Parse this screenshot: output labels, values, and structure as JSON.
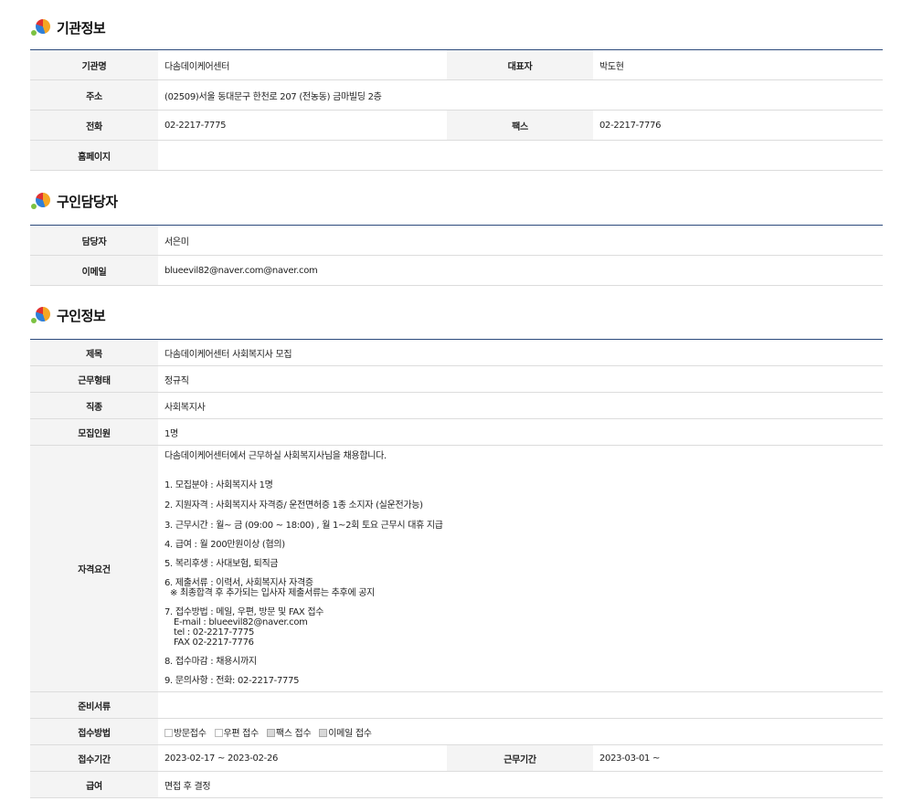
{
  "sections": {
    "org": {
      "title": "기관정보",
      "labels": {
        "name": "기관명",
        "rep": "대표자",
        "address": "주소",
        "phone": "전화",
        "fax": "팩스",
        "homepage": "홈페이지"
      },
      "values": {
        "name": "다솜데이케어센터",
        "rep": "박도현",
        "address": "(02509)서울 동대문구 한천로 207 (전농동) 금마빌딩 2층",
        "phone": "02-2217-7775",
        "fax": "02-2217-7776",
        "homepage": ""
      }
    },
    "contact": {
      "title": "구인담당자",
      "labels": {
        "person": "담당자",
        "email": "이메일"
      },
      "values": {
        "person": "서은미",
        "email": "blueevil82@naver.com@naver.com"
      }
    },
    "job": {
      "title": "구인정보",
      "labels": {
        "subject": "제목",
        "type": "근무형태",
        "category": "직종",
        "count": "모집인원",
        "qualification": "자격요건",
        "documents": "준비서류",
        "method": "접수방법",
        "period": "접수기간",
        "start": "근무기간",
        "salary": "급여"
      },
      "values": {
        "subject": "다솜데이케어센터 사회복지사 모집",
        "type": "정규직",
        "category": "사회복지사",
        "count": "1명",
        "qualification": {
          "intro": "다솜데이케어센터에서 근무하실 사회복지사님을 채용합니다.",
          "item1": "1. 모집분야 : 사회복지사 1명",
          "item2": "2. 지원자격 : 사회복지사 자격증/ 운전면허증 1종 소지자 (실운전가능)",
          "item3": "3. 근무시간 : 월~ 금 (09:00 ~ 18:00) , 월 1~2회 토요 근무시 대휴 지급",
          "item4": "4. 급여 : 월 200만원이상 (협의)",
          "item5": "5. 복리후생 : 사대보험, 퇴직금",
          "item6": "6. 제출서류 : 이력서, 사회복지사 자격증",
          "item6_note": "※ 최종합격 후 추가되는 입사자 제출서류는 추후에 공지",
          "item7": "7. 접수방법 : 메일, 우편, 방문 및 FAX 접수",
          "item7_email": "E-mail : blueevil82@naver.com",
          "item7_tel": "tel : 02-2217-7775",
          "item7_fax": "FAX 02-2217-7776",
          "item8": "8. 접수마감 : 채용시까지",
          "item9": "9. 문의사항 : 전화: 02-2217-7775"
        },
        "documents": "",
        "method_options": [
          {
            "label": "방문접수",
            "checked": false
          },
          {
            "label": "우편 접수",
            "checked": false
          },
          {
            "label": "팩스 접수",
            "checked": true
          },
          {
            "label": "이메일 접수",
            "checked": true
          }
        ],
        "period": "2023-02-17 ~ 2023-02-26",
        "start": "2023-03-01 ~",
        "salary": "면접 후 결정"
      }
    }
  }
}
